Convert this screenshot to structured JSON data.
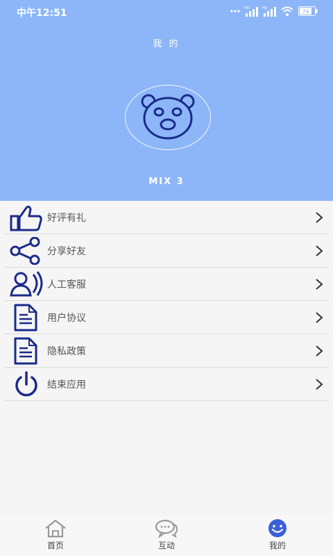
{
  "status": {
    "time": "中午12:51",
    "battery": "74",
    "hd1": "HD",
    "hd2": "HD"
  },
  "header": {
    "title": "我 的",
    "username": "MIX 3",
    "background": "#8cb6f7"
  },
  "menu": {
    "items": [
      {
        "label": "好评有礼",
        "icon": "thumbs-up-icon"
      },
      {
        "label": "分享好友",
        "icon": "share-icon"
      },
      {
        "label": "人工客服",
        "icon": "customer-service-icon"
      },
      {
        "label": "用户协议",
        "icon": "document-icon"
      },
      {
        "label": "隐私政策",
        "icon": "document-icon"
      },
      {
        "label": "结束应用",
        "icon": "power-icon"
      }
    ]
  },
  "nav": {
    "items": [
      {
        "label": "首页",
        "icon": "home-icon"
      },
      {
        "label": "互动",
        "icon": "chat-icon"
      },
      {
        "label": "我的",
        "icon": "smile-icon",
        "active": true
      }
    ]
  },
  "colors": {
    "accent": "#1a2a8a",
    "active_nav": "#3b5fd9"
  }
}
